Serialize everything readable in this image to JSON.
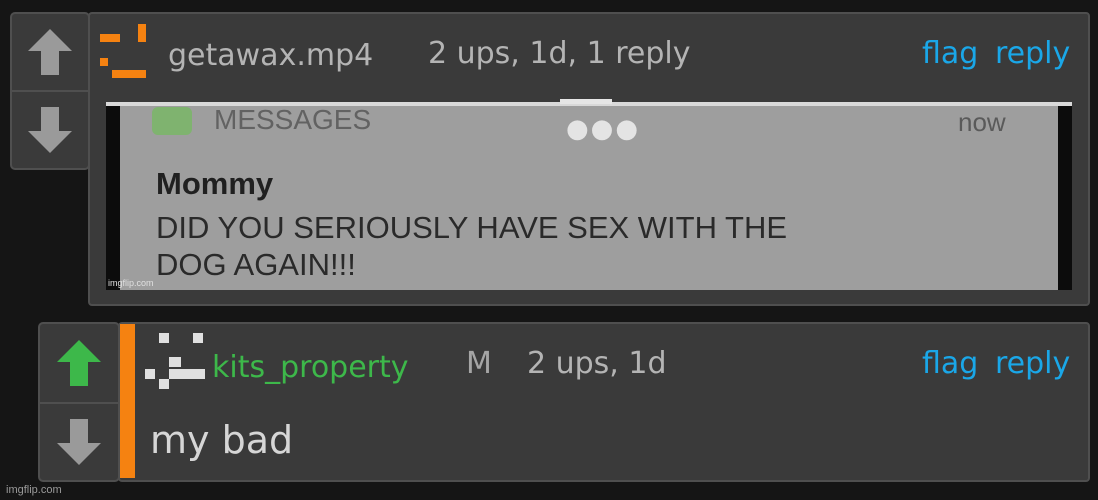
{
  "comments": [
    {
      "username": "getawax.mp4",
      "meta": "2 ups, 1d, 1 reply",
      "flag_label": "flag",
      "reply_label": "reply",
      "username_color": "#b4b4b4",
      "avatar_color": "#f58211",
      "upvote_state": "neutral",
      "attachment": {
        "app_name": "MESSAGES",
        "time": "now",
        "sender": "Mommy",
        "message_line_1": "DID YOU SERIOUSLY HAVE SEX WITH THE",
        "message_line_2": "DOG AGAIN!!!",
        "watermark": "imgflip.com"
      }
    },
    {
      "username": "kits_property",
      "mod_badge": "M",
      "meta": "2 ups, 1d",
      "flag_label": "flag",
      "reply_label": "reply",
      "body": "my bad",
      "username_color": "#3db84a",
      "avatar_color": "#e0e0e0",
      "upvote_state": "upvoted",
      "upvote_color": "#3db84a"
    }
  ],
  "colors": {
    "link": "#1aa7e8",
    "accent": "#f58211",
    "panel": "#3a3a3a",
    "background": "#151515"
  },
  "watermark": "imgflip.com"
}
